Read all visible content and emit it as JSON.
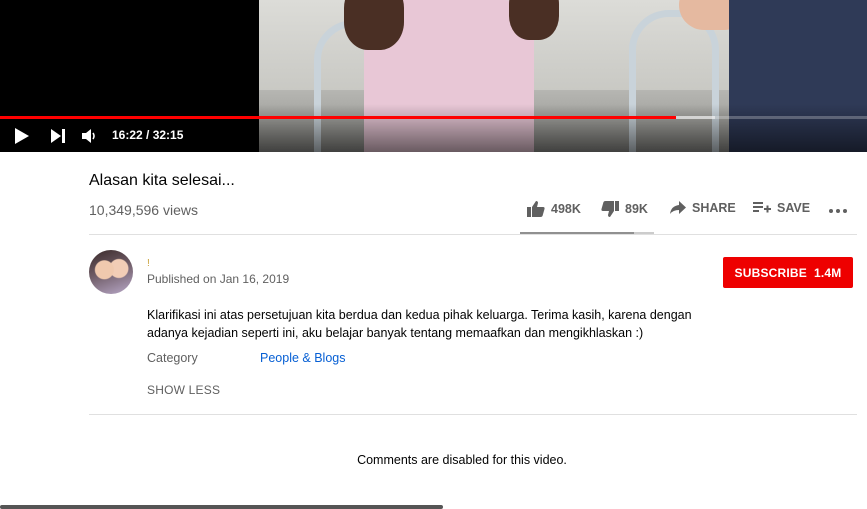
{
  "player": {
    "time": "16:22 / 32:15",
    "progress": 0.78
  },
  "video": {
    "title": "Alasan kita selesai...",
    "views": "10,349,596 views",
    "likes": "498K",
    "dislikes": "89K",
    "share_label": "SHARE",
    "save_label": "SAVE",
    "like_ratio": 0.85
  },
  "channel": {
    "name": "!",
    "published": "Published on Jan 16, 2019",
    "subscribe_label": "SUBSCRIBE",
    "subscriber_count": "1.4M"
  },
  "description": {
    "text": "Klarifikasi ini atas persetujuan kita berdua dan kedua pihak keluarga. Terima kasih, karena dengan adanya kejadian seperti ini, aku belajar banyak tentang memaafkan dan mengikhlaskan :)",
    "category_label": "Category",
    "category_value": "People & Blogs",
    "show_less": "SHOW LESS"
  },
  "comments": {
    "disabled_text": "Comments are disabled for this video."
  },
  "colors": {
    "accent": "#ff0000",
    "subscribe": "#ee0000",
    "link": "#065fd4"
  }
}
